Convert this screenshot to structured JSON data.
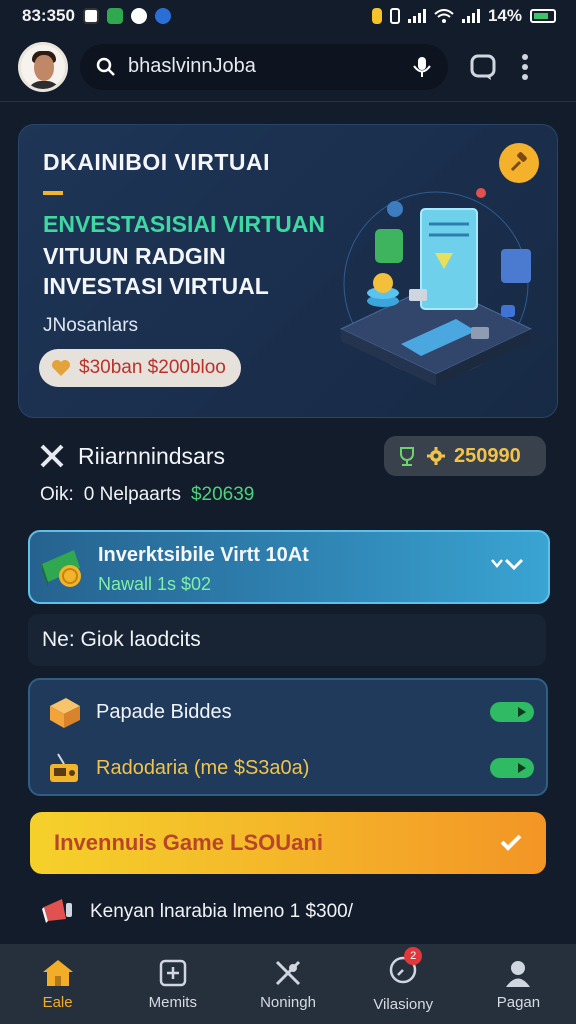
{
  "status_bar": {
    "time": "83:350",
    "battery": "14%"
  },
  "header": {
    "search_text": "bhaslvinnJoba"
  },
  "hero": {
    "title": "DKAINIBOI VIRTUAI",
    "accent_line": "ENVESTASISIAI VIRTUAN",
    "line2": "VITUUN RADGIN",
    "line3": "INVESTASI VIRTUAL",
    "subtitle": "JNosanlars",
    "pill_text": "$30ban $200bloo"
  },
  "rankings": {
    "label": "Riiarnnindsars",
    "badge_value": "250990"
  },
  "balance": {
    "prefix": "Oik:",
    "label": "0 Nelpaarts",
    "amount": "$20639"
  },
  "invest_card": {
    "title": "Inverktsibile Virtt 10At",
    "subtitle": "Nawall 1s $02"
  },
  "section": {
    "title": "Ne: Giok laodcits"
  },
  "products": [
    {
      "label": "Papade Biddes",
      "color": "#f2f4f8"
    },
    {
      "label": "Radodaria (me $S3a0a)",
      "color": "#f1c34a"
    }
  ],
  "game_banner": {
    "label": "Invennuis Game  LSOUani"
  },
  "info": {
    "label": "Kenyan lnarabia lmeno 1 $300/"
  },
  "bottom_nav": [
    {
      "label": "Eale",
      "active": true
    },
    {
      "label": "Memits",
      "active": false
    },
    {
      "label": "Noningh",
      "active": false
    },
    {
      "label": "Vilasiony",
      "active": false,
      "badge": "2"
    },
    {
      "label": "Pagan",
      "active": false
    }
  ],
  "colors": {
    "background": "#131c2b",
    "accent_orange": "#f3ae29",
    "accent_green": "#3fd8a2",
    "card_blue": "#2f84b3"
  }
}
